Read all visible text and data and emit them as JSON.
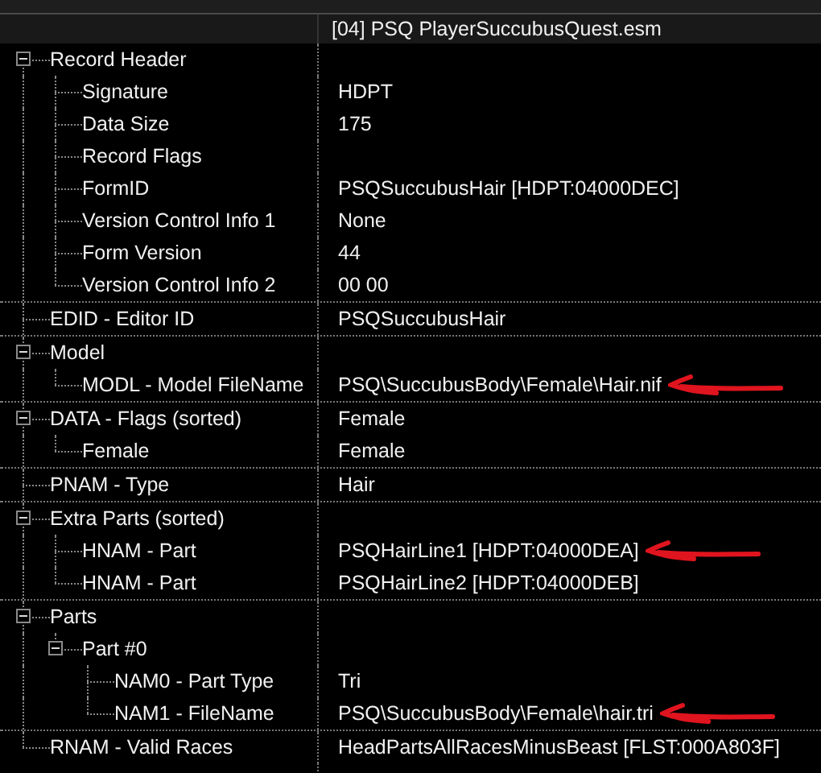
{
  "header": {
    "title": "[04] PSQ PlayerSuccubusQuest.esm"
  },
  "tree": [
    {
      "label": "Record Header",
      "expanded": true,
      "children": [
        {
          "label": "Signature",
          "value": "HDPT"
        },
        {
          "label": "Data Size",
          "value": "175"
        },
        {
          "label": "Record Flags"
        },
        {
          "label": "FormID",
          "value": "PSQSuccubusHair [HDPT:04000DEC]"
        },
        {
          "label": "Version Control Info 1",
          "value": "None"
        },
        {
          "label": "Form Version",
          "value": "44"
        },
        {
          "label": "Version Control Info 2",
          "value": "00 00"
        }
      ]
    },
    {
      "label": "EDID - Editor ID",
      "value": "PSQSuccubusHair"
    },
    {
      "label": "Model",
      "expanded": true,
      "children": [
        {
          "label": "MODL - Model FileName",
          "value": "PSQ\\SuccubusBody\\Female\\Hair.nif",
          "annotated": true
        }
      ]
    },
    {
      "label": "DATA - Flags (sorted)",
      "value": "Female",
      "expanded": true,
      "children": [
        {
          "label": "Female",
          "value": "Female"
        }
      ]
    },
    {
      "label": "PNAM - Type",
      "value": "Hair"
    },
    {
      "label": "Extra Parts (sorted)",
      "expanded": true,
      "children": [
        {
          "label": "HNAM - Part",
          "value": "PSQHairLine1 [HDPT:04000DEA]",
          "annotated": true
        },
        {
          "label": "HNAM - Part",
          "value": "PSQHairLine2 [HDPT:04000DEB]"
        }
      ]
    },
    {
      "label": "Parts",
      "expanded": true,
      "children": [
        {
          "label": "Part #0",
          "expanded": true,
          "children": [
            {
              "label": "NAM0 - Part Type",
              "value": "Tri"
            },
            {
              "label": "NAM1 - FileName",
              "value": "PSQ\\SuccubusBody\\Female\\hair.tri",
              "annotated": true
            }
          ]
        }
      ]
    },
    {
      "label": "RNAM - Valid Races",
      "value": "HeadPartsAllRacesMinusBeast [FLST:000A803F]"
    }
  ]
}
